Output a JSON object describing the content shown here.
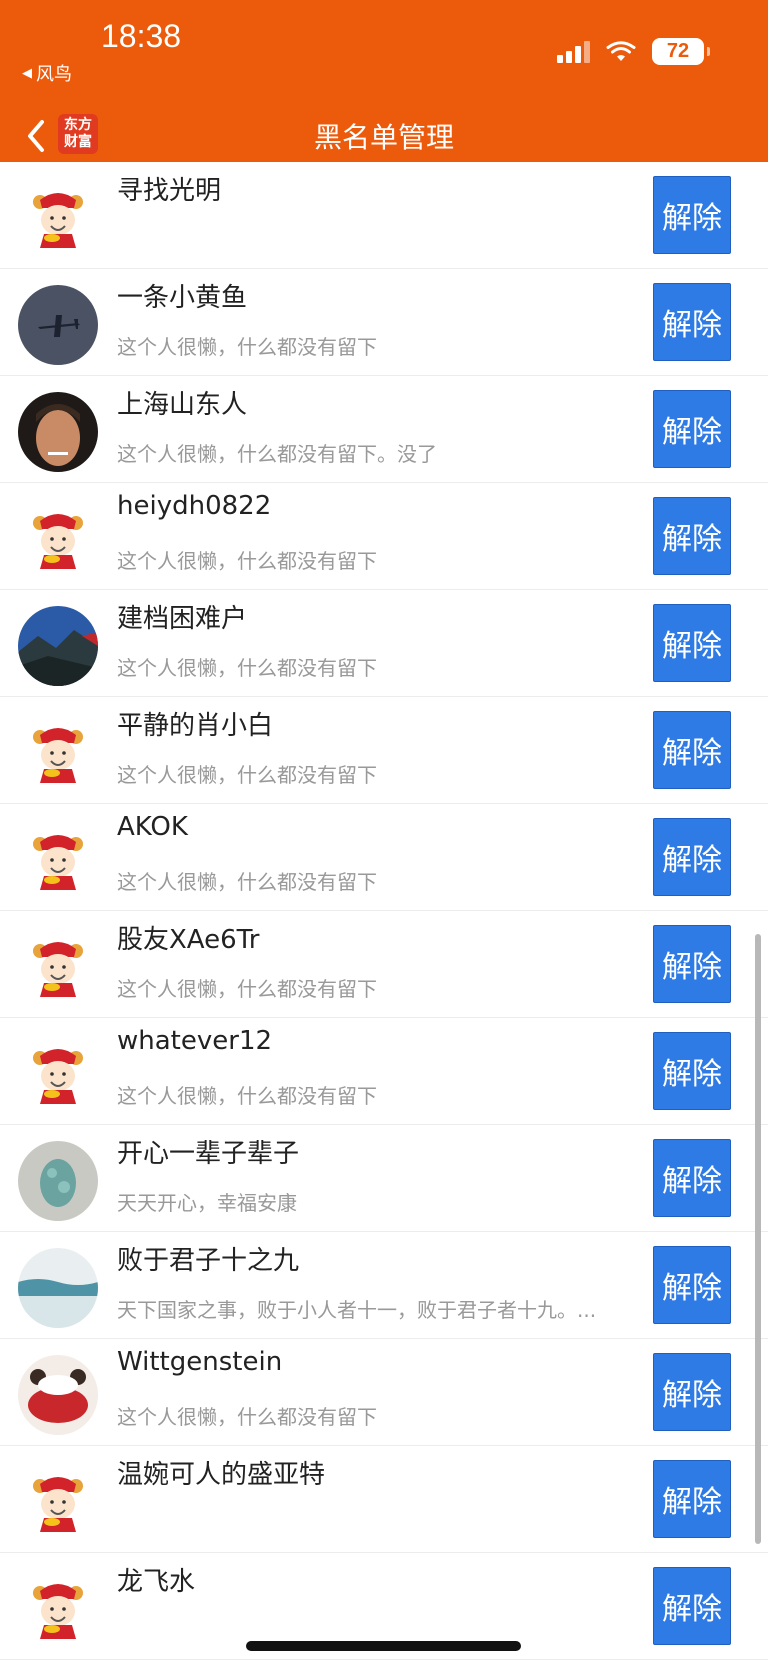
{
  "status": {
    "time": "18:38",
    "back_app": "风鸟",
    "battery": "72"
  },
  "nav": {
    "logo_line1": "东方",
    "logo_line2": "财富",
    "title": "黑名单管理"
  },
  "colors": {
    "header_bg": "#ec5a0b",
    "button_bg": "#2f7be5"
  },
  "rows": [
    {
      "name": "寻找光明",
      "sign": "",
      "button": "解除",
      "avatar": "mascot-avatar"
    },
    {
      "name": "一条小黄鱼",
      "sign": "这个人很懒，什么都没有留下",
      "button": "解除",
      "avatar": "airplane-avatar"
    },
    {
      "name": "上海山东人",
      "sign": "这个人很懒，什么都没有留下。没了",
      "button": "解除",
      "avatar": "face-avatar"
    },
    {
      "name": "heiydh0822",
      "sign": "这个人很懒，什么都没有留下",
      "button": "解除",
      "avatar": "mascot-avatar"
    },
    {
      "name": "建档困难户",
      "sign": "这个人很懒，什么都没有留下",
      "button": "解除",
      "avatar": "landscape-avatar"
    },
    {
      "name": "平静的肖小白",
      "sign": "这个人很懒，什么都没有留下",
      "button": "解除",
      "avatar": "mascot-avatar"
    },
    {
      "name": "AKOK",
      "sign": "这个人很懒，什么都没有留下",
      "button": "解除",
      "avatar": "mascot-avatar"
    },
    {
      "name": "股友XAe6Tr",
      "sign": "这个人很懒，什么都没有留下",
      "button": "解除",
      "avatar": "mascot-avatar"
    },
    {
      "name": "whatever12",
      "sign": "这个人很懒，什么都没有留下",
      "button": "解除",
      "avatar": "mascot-avatar"
    },
    {
      "name": "开心一辈子辈子",
      "sign": "天天开心，幸福安康",
      "button": "解除",
      "avatar": "jade-avatar"
    },
    {
      "name": "败于君子十之九",
      "sign": "天下国家之事，败于小人者十一，败于君子者十九。...",
      "button": "解除",
      "avatar": "water-avatar"
    },
    {
      "name": "Wittgenstein",
      "sign": "这个人很懒，什么都没有留下",
      "button": "解除",
      "avatar": "cartoon-avatar"
    },
    {
      "name": "温婉可人的盛亚特",
      "sign": "",
      "button": "解除",
      "avatar": "mascot-avatar"
    },
    {
      "name": "龙飞水",
      "sign": "",
      "button": "解除",
      "avatar": "mascot-avatar"
    }
  ]
}
